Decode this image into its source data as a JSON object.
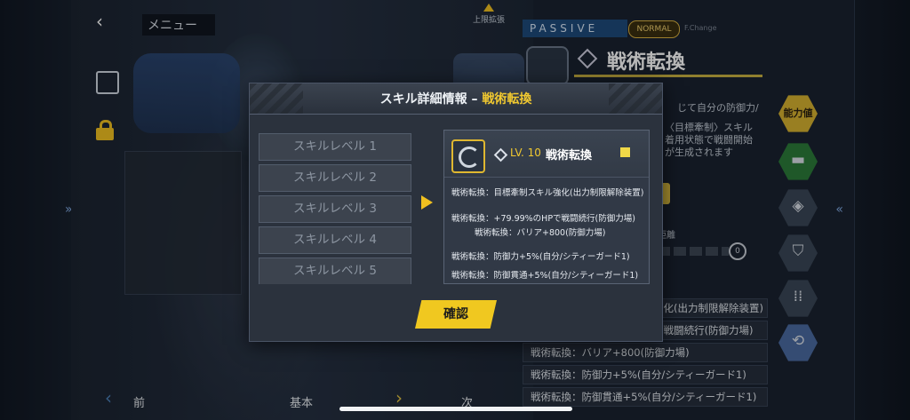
{
  "nav": {
    "menu_label": "メニュー",
    "upper_limit_label": "上限拡張"
  },
  "skill_panel": {
    "passive_label": "PASSIVE",
    "normal_tag": "NORMAL",
    "f_change": "F.Change",
    "skill_name": "戦術転換",
    "bg_text_1": "じて自分の防御力/",
    "bg_text_2": "〈目標牽制〉スキル",
    "bg_text_3": "着用状態で戦闘開始",
    "bg_text_4": "が生成されます",
    "distance_label": "距離",
    "gauge_value": "0",
    "effects": [
      "戦術転換：目標牽制スキル強化(出力制限解除装置)",
      "戦術転換：+79.99%のHPで戦闘続行(防御力場)",
      "戦術転換：バリア+800(防御力場)",
      "戦術転換：防御力+5%(自分/シティーガード1)",
      "戦術転換：防御貫通+5%(自分/シティーガード1)"
    ]
  },
  "categories": [
    {
      "label": "能力値"
    }
  ],
  "bottom": {
    "prev_label": "前",
    "basic_label": "基本",
    "next_label": "次"
  },
  "modal": {
    "title_left": "スキル詳細情報 – ",
    "title_right": "戦術転換",
    "levels": [
      "スキルレベル 1",
      "スキルレベル 2",
      "スキルレベル 3",
      "スキルレベル 4",
      "スキルレベル 5"
    ],
    "detail": {
      "level": "LV. 10",
      "name": "戦術転換",
      "effects": [
        "戦術転換：目標牽制スキル強化(出力制限解除装置)",
        "戦術転換：+79.99%のHPで戦闘続行(防御力場)",
        "戦術転換：バリア+800(防御力場)",
        "戦術転換：防御力+5%(自分/シティーガード1)",
        "戦術転換：防御貫通+5%(自分/シティーガード1)"
      ]
    },
    "confirm_label": "確認"
  },
  "colors": {
    "accent_yellow": "#f0c820",
    "passive_blue": "#1e4a7a",
    "panel_bg": "#2b323d"
  }
}
